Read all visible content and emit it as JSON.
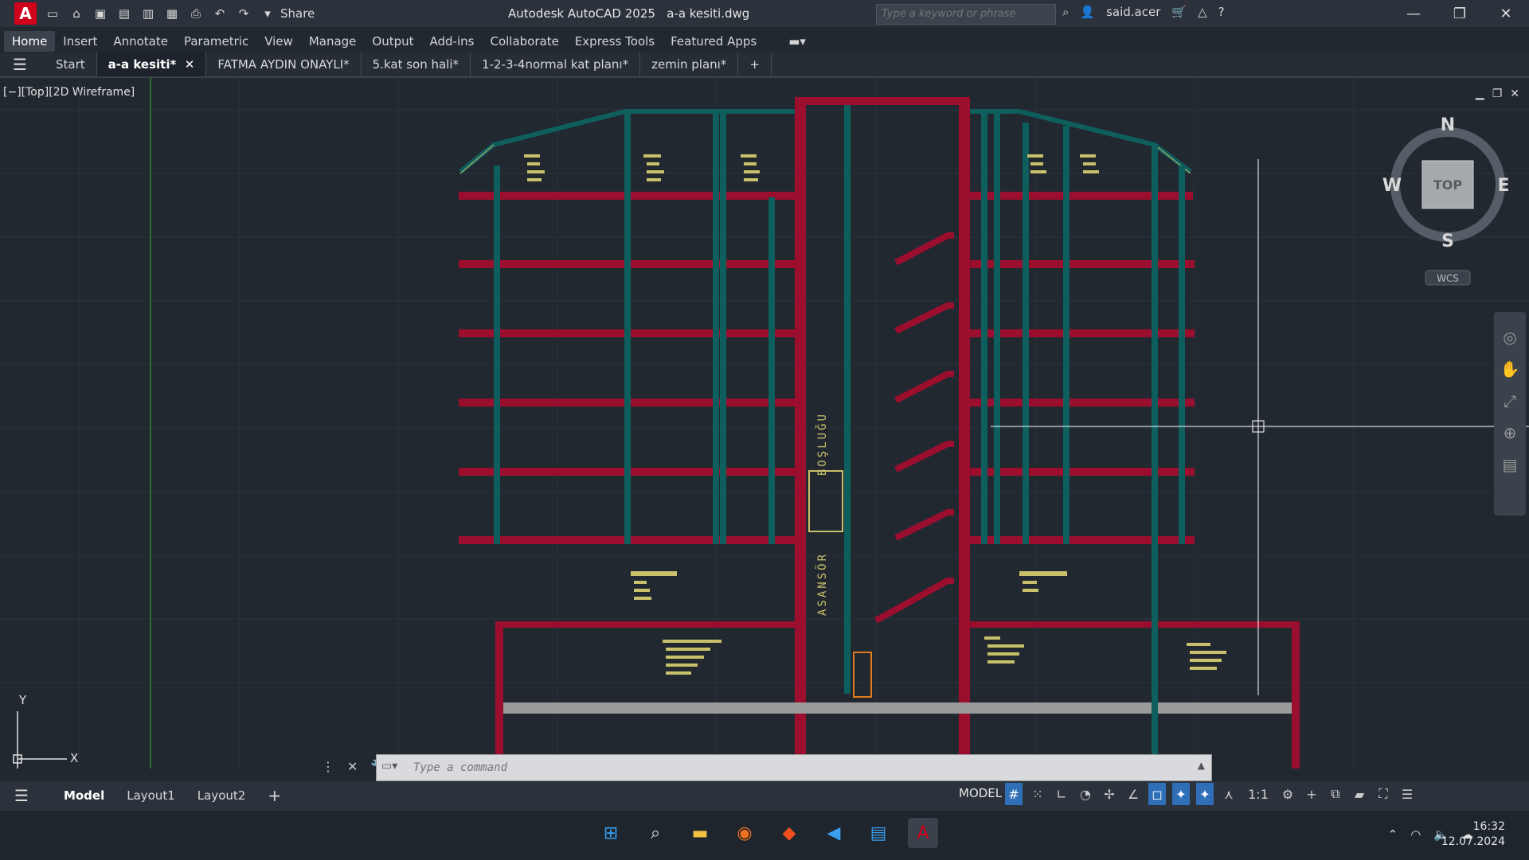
{
  "titlebar": {
    "app_name": "Autodesk AutoCAD 2025",
    "file_name": "a-a kesiti.dwg",
    "share_label": "Share",
    "search_placeholder": "Type a keyword or phrase",
    "user": "said.acer"
  },
  "ribbon_tabs": [
    "Home",
    "Insert",
    "Annotate",
    "Parametric",
    "View",
    "Manage",
    "Output",
    "Add-ins",
    "Collaborate",
    "Express Tools",
    "Featured Apps"
  ],
  "file_tabs": [
    "Start",
    "a-a kesiti*",
    "FATMA AYDIN ONAYLI*",
    "5.kat son hali*",
    "1-2-3-4normal kat planı*",
    "zemin planı*"
  ],
  "viewport": {
    "label": "[−][Top][2D Wireframe]",
    "viewcube_top": "TOP",
    "compass_n": "N",
    "compass_s": "S",
    "compass_e": "E",
    "compass_w": "W",
    "wcs": "WCS",
    "ucs_x": "X",
    "ucs_y": "Y"
  },
  "drawing": {
    "shaft_text_upper": "BOŞLUĞU",
    "shaft_text_lower": "ASANSÖR"
  },
  "command": {
    "placeholder": "Type a command"
  },
  "layout_tabs": [
    "Model",
    "Layout1",
    "Layout2"
  ],
  "status": {
    "model": "MODEL",
    "scale": "1:1"
  },
  "clock": {
    "time": "16:32",
    "date": "12.07.2024"
  },
  "colors": {
    "wall": "#9c0e2e",
    "column": "#0e5e5e",
    "annotation": "#c8c06a",
    "background": "#212830"
  }
}
